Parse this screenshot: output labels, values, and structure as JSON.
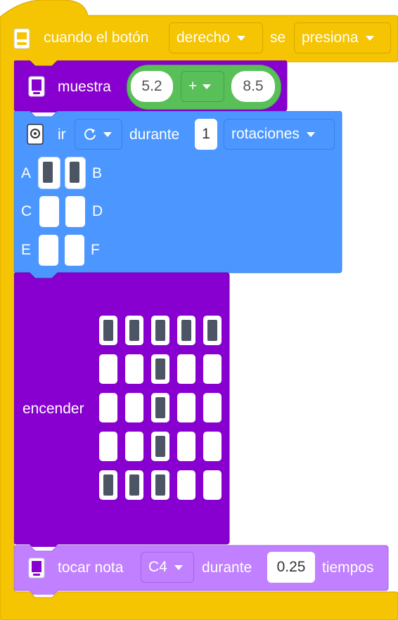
{
  "colors": {
    "event": "#f5c402",
    "display": "#8800d0",
    "motor": "#4c97ff",
    "operator": "#59c059",
    "sound": "#c080ff"
  },
  "event_block": {
    "label_when": "cuando el botón",
    "button_value": "derecho",
    "label_se": "se",
    "action_value": "presiona",
    "icon": "hub-icon"
  },
  "show_block": {
    "label": "muestra",
    "left_value": "5.2",
    "operator": "+",
    "right_value": "8.5",
    "icon": "light-matrix-icon"
  },
  "motor_block": {
    "label_go": "ir",
    "direction_icon": "clockwise-icon",
    "label_for": "durante",
    "amount": "1",
    "unit": "rotaciones",
    "icon": "motor-icon",
    "ports": [
      {
        "label": "A",
        "selected": true
      },
      {
        "label": "B",
        "selected": true
      },
      {
        "label": "C",
        "selected": false
      },
      {
        "label": "D",
        "selected": false
      },
      {
        "label": "E",
        "selected": false
      },
      {
        "label": "F",
        "selected": false
      }
    ]
  },
  "light_block": {
    "label": "encender",
    "grid": [
      [
        1,
        1,
        1,
        1,
        1
      ],
      [
        0,
        0,
        1,
        0,
        0
      ],
      [
        0,
        0,
        1,
        0,
        0
      ],
      [
        0,
        0,
        1,
        0,
        0
      ],
      [
        1,
        1,
        1,
        0,
        0
      ]
    ]
  },
  "sound_block": {
    "label": "tocar nota",
    "note": "C4",
    "label_for": "durante",
    "duration": "0.25",
    "label_beats": "tiempos",
    "icon": "speaker-icon"
  }
}
